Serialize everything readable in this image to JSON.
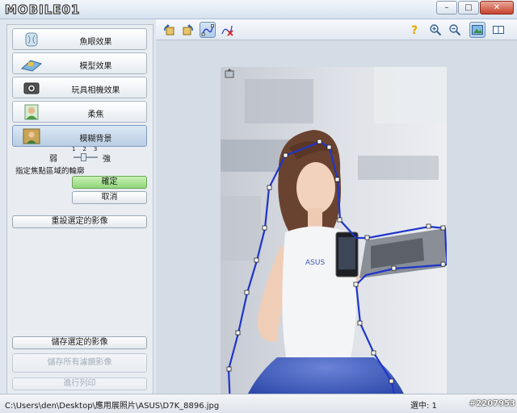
{
  "titlebar": {
    "logo": "MOBILE01"
  },
  "left_panel": {
    "effects": [
      {
        "label": "魚眼效果",
        "icon": "fisheye-icon"
      },
      {
        "label": "模型效果",
        "icon": "miniature-icon"
      },
      {
        "label": "玩具相機效果",
        "icon": "toy-camera-icon"
      },
      {
        "label": "柔焦",
        "icon": "soft-focus-icon"
      },
      {
        "label": "模糊背景",
        "icon": "blur-background-icon",
        "selected": true
      }
    ],
    "slider": {
      "weak_label": "弱",
      "strong_label": "強",
      "ticks": "123",
      "value": 2
    },
    "instruction": "指定焦點區域的輪廓",
    "ok_label": "確定",
    "cancel_label": "取消",
    "reset_label": "重設選定的影像",
    "save_selected_label": "儲存選定的影像",
    "save_all_label": "儲存所有濾鏡影像",
    "print_label": "進行列印"
  },
  "toolbar": {
    "left_icons": [
      "rotate-left-icon",
      "rotate-right-icon",
      "outline-tool-icon",
      "clear-outline-icon"
    ],
    "right_icons": [
      "help-icon",
      "zoom-in-icon",
      "zoom-out-icon",
      "single-view-icon",
      "dual-view-icon"
    ]
  },
  "statusbar": {
    "path": "C:\\Users\\den\\Desktop\\應用展照片\\ASUS\\D7K_8896.jpg",
    "selected": "選中: 1",
    "watermark": "#2207953"
  },
  "colors": {
    "accent": "#2a3fbf",
    "ok_button": "#8fd57a",
    "panel": "#e9edf2"
  }
}
